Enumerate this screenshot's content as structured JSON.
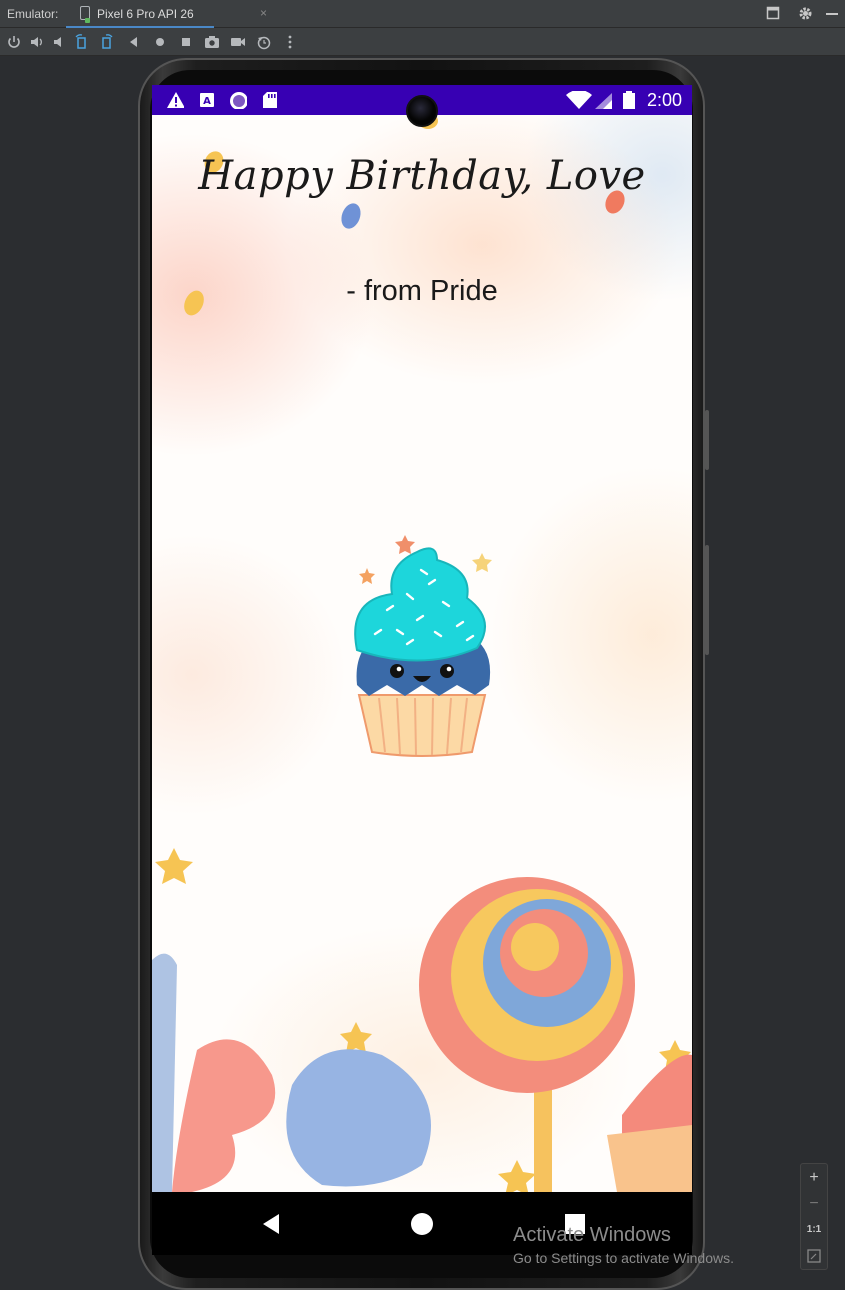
{
  "ide": {
    "emulator_label": "Emulator:",
    "device_tab_label": "Pixel 6 Pro API 26",
    "tab_close_glyph": "×",
    "toolbar_icons": [
      "power-icon",
      "volume-up-icon",
      "volume-down-icon",
      "rotate-left-icon",
      "rotate-right-icon",
      "back-icon",
      "home-icon",
      "overview-icon",
      "camera-icon",
      "record-icon",
      "replay-icon",
      "more-icon"
    ],
    "window_controls": [
      "restore-icon",
      "settings-icon",
      "minimize-icon"
    ]
  },
  "phone": {
    "status_bar": {
      "time": "2:00",
      "color": "#3700b3",
      "left_icons": [
        "warning-icon",
        "a-notification-icon",
        "circle-notification-icon",
        "sd-card-icon"
      ],
      "right_icons": [
        "wifi-icon",
        "signal-icon",
        "battery-icon"
      ]
    },
    "app": {
      "title": "Happy Birthday, Love",
      "subtitle": "- from Pride",
      "image": "cupcake-illustration"
    },
    "nav_bar": {
      "buttons": [
        "back-triangle-icon",
        "home-circle-icon",
        "recents-square-icon"
      ]
    }
  },
  "overlay": {
    "activate_title": "Activate Windows",
    "activate_sub": "Go to Settings to activate Windows."
  },
  "zoom_controls": {
    "plus": "+",
    "minus": "−",
    "one_to_one": "1:1"
  }
}
